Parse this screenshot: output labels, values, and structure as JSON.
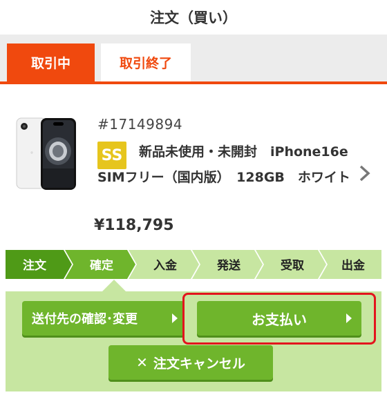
{
  "header": {
    "title": "注文（買い）"
  },
  "tabs": [
    {
      "label": "取引中",
      "active": true
    },
    {
      "label": "取引終了",
      "active": false
    }
  ],
  "product": {
    "id": "#17149894",
    "badge": "SS",
    "title": "新品未使用・未開封　iPhone16e SIMフリー（国内版）　128GB　ホワイト",
    "price": "¥118,795"
  },
  "steps": [
    {
      "label": "注文",
      "state": "done"
    },
    {
      "label": "確定",
      "state": "current"
    },
    {
      "label": "入金",
      "state": "todo"
    },
    {
      "label": "発送",
      "state": "todo"
    },
    {
      "label": "受取",
      "state": "todo"
    },
    {
      "label": "出金",
      "state": "todo"
    }
  ],
  "actions": {
    "address_label": "送付先の確認･変更",
    "pay_label": "お支払い",
    "cancel_label": "注文キャンセル"
  },
  "colors": {
    "accent": "#f0490e",
    "button_green": "#6fb52c",
    "step_done": "#4f9a17",
    "step_current": "#6fb52c",
    "step_todo": "#c7e6a1",
    "highlight": "#e3141d",
    "badge": "#e6c51d"
  }
}
